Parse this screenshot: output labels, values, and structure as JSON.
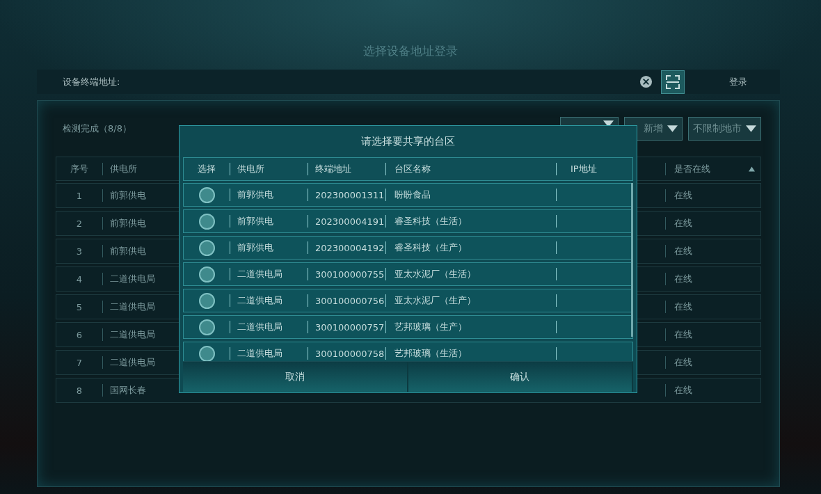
{
  "page_title": "选择设备地址登录",
  "address_bar": {
    "label": "设备终端地址:",
    "login_button": "登录"
  },
  "panel": {
    "status": "检测完成（8/8）",
    "dropdowns": [
      {
        "label": "新增"
      },
      {
        "label": "不限制地市"
      }
    ],
    "table": {
      "columns": [
        "序号",
        "供电所",
        "是否在线"
      ],
      "rows": [
        [
          "1",
          "前郭供电",
          "在线"
        ],
        [
          "2",
          "前郭供电",
          "在线"
        ],
        [
          "3",
          "前郭供电",
          "在线"
        ],
        [
          "4",
          "二道供电局",
          "在线"
        ],
        [
          "5",
          "二道供电局",
          "在线"
        ],
        [
          "6",
          "二道供电局",
          "在线"
        ],
        [
          "7",
          "二道供电局",
          "在线"
        ],
        [
          "8",
          "国网长春",
          "在线"
        ]
      ]
    }
  },
  "dialog": {
    "title": "请选择要共享的台区",
    "columns": [
      "选择",
      "供电所",
      "终端地址",
      "台区名称",
      "IP地址"
    ],
    "rows": [
      {
        "selected": false,
        "station": "前郭供电",
        "terminal": "202300001311",
        "area": "盼盼食品"
      },
      {
        "selected": false,
        "station": "前郭供电",
        "terminal": "202300004191",
        "area": "睿圣科技（生活）"
      },
      {
        "selected": false,
        "station": "前郭供电",
        "terminal": "202300004192",
        "area": "睿圣科技（生产）"
      },
      {
        "selected": false,
        "station": "二道供电局",
        "terminal": "300100000755",
        "area": "亚太水泥厂（生活）"
      },
      {
        "selected": false,
        "station": "二道供电局",
        "terminal": "300100000756",
        "area": "亚太水泥厂（生产）"
      },
      {
        "selected": false,
        "station": "二道供电局",
        "terminal": "300100000757",
        "area": "艺邦玻璃（生产）"
      },
      {
        "selected": false,
        "station": "二道供电局",
        "terminal": "300100000758",
        "area": "艺邦玻璃（生活）"
      }
    ],
    "buttons": [
      "取消",
      "确认"
    ]
  }
}
